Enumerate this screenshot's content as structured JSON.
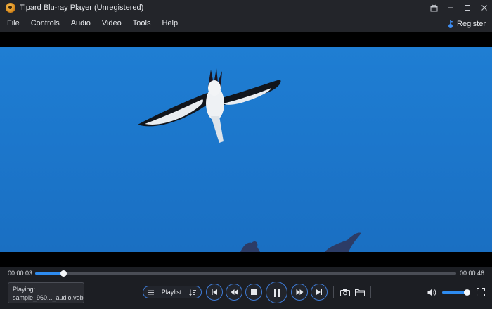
{
  "window": {
    "title": "Tipard Blu-ray Player (Unregistered)"
  },
  "menu": {
    "items": [
      "File",
      "Controls",
      "Audio",
      "Video",
      "Tools",
      "Help"
    ],
    "register_label": "Register"
  },
  "playback": {
    "current_time": "00:00:03",
    "total_time": "00:00:46",
    "progress_fraction": 0.066,
    "now_playing_label": "Playing:",
    "now_playing_file": "sample_960..._audio.vob",
    "volume_fraction": 0.87
  },
  "controls": {
    "playlist_label": "Playlist"
  },
  "icons": {
    "logo": "tipard-logo-icon",
    "gift": "gift-icon",
    "minimize": "minimize-icon",
    "maximize": "maximize-icon",
    "close": "close-icon",
    "register": "key-icon"
  },
  "colors": {
    "accent": "#2e8cf0",
    "button_border": "#3e7bd6",
    "background": "#1c1e23"
  }
}
